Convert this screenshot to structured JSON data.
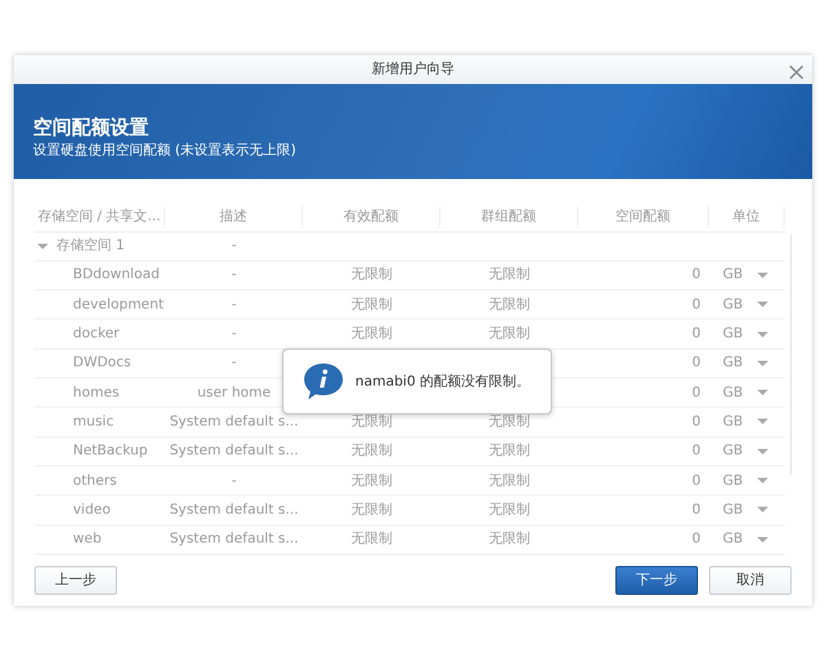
{
  "window": {
    "title": "新增用户向导"
  },
  "banner": {
    "title": "空间配额设置",
    "subtitle": "设置硬盘使用空间配额 (未设置表示无上限)"
  },
  "table": {
    "columns": [
      "存储空间 / 共享文...",
      "描述",
      "有效配额",
      "群组配额",
      "空间配额",
      "单位"
    ],
    "rows": [
      {
        "name": "存储空间 1",
        "description": "-",
        "expanded": true,
        "children": [
          {
            "name": "BDdownload",
            "description": "-",
            "effective_quota": "无限制",
            "group_quota": "无限制",
            "space_quota": "0",
            "unit": "GB"
          },
          {
            "name": "development",
            "description": "-",
            "effective_quota": "无限制",
            "group_quota": "无限制",
            "space_quota": "0",
            "unit": "GB"
          },
          {
            "name": "docker",
            "description": "-",
            "effective_quota": "无限制",
            "group_quota": "无限制",
            "space_quota": "0",
            "unit": "GB"
          },
          {
            "name": "DWDocs",
            "description": "-",
            "space_quota": "0",
            "unit": "GB"
          },
          {
            "name": "homes",
            "description": "user home",
            "space_quota": "0",
            "unit": "GB"
          },
          {
            "name": "music",
            "description": "System default s...",
            "effective_quota": "无限制",
            "group_quota": "无限制",
            "space_quota": "0",
            "unit": "GB"
          },
          {
            "name": "NetBackup",
            "description": "System default s...",
            "effective_quota": "无限制",
            "group_quota": "无限制",
            "space_quota": "0",
            "unit": "GB"
          },
          {
            "name": "others",
            "description": "-",
            "effective_quota": "无限制",
            "group_quota": "无限制",
            "space_quota": "0",
            "unit": "GB"
          },
          {
            "name": "video",
            "description": "System default s...",
            "effective_quota": "无限制",
            "group_quota": "无限制",
            "space_quota": "0",
            "unit": "GB"
          },
          {
            "name": "web",
            "description": "System default s...",
            "effective_quota": "无限制",
            "group_quota": "无限制",
            "space_quota": "0",
            "unit": "GB"
          }
        ]
      }
    ]
  },
  "info_popup": {
    "message": "namabi0 的配额没有限制。"
  },
  "buttons": [
    {
      "label": "上一步",
      "kind": "secondary"
    },
    {
      "label": "下一步",
      "kind": "primary"
    },
    {
      "label": "取消",
      "kind": "secondary"
    }
  ]
}
